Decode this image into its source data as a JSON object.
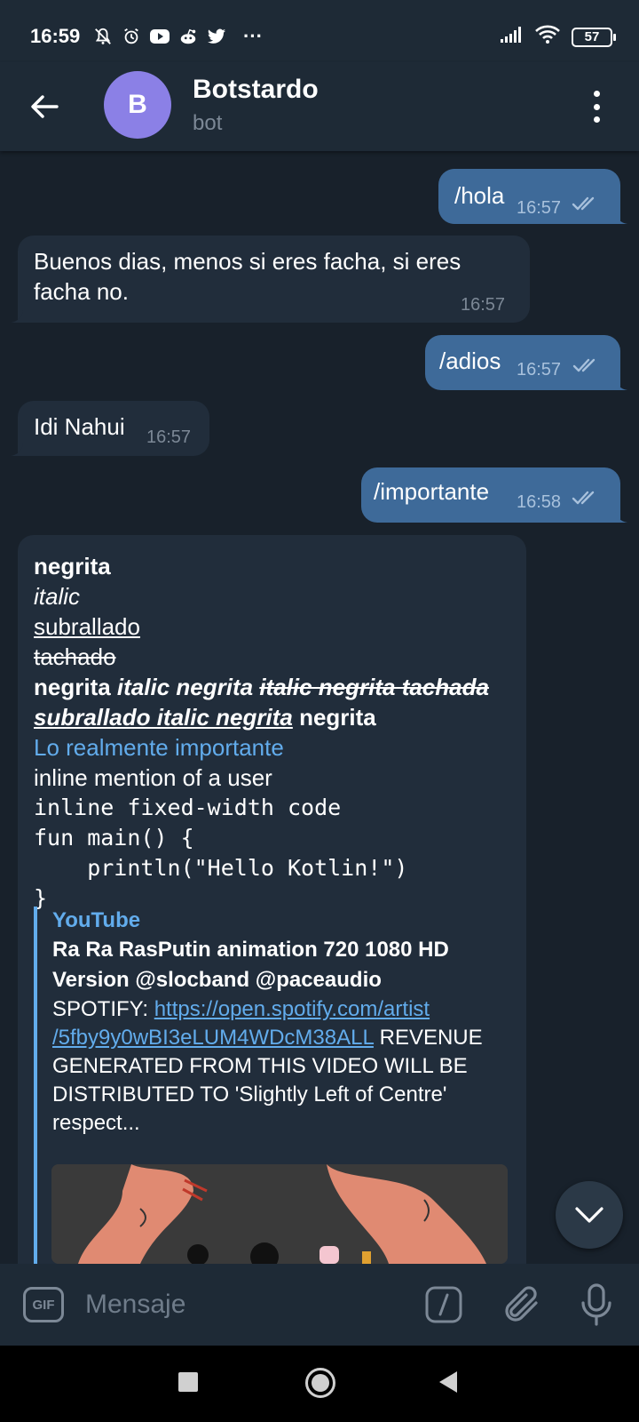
{
  "status_bar": {
    "time": "16:59",
    "battery": "57",
    "more": "···"
  },
  "header": {
    "avatar_letter": "B",
    "title": "Botstardo",
    "subtitle": "bot"
  },
  "messages": [
    {
      "direction": "out",
      "text": "/hola",
      "time": "16:57",
      "status": "read"
    },
    {
      "direction": "in",
      "text_line1": "Buenos dias, menos si eres facha, si eres",
      "text_line2": "facha no.",
      "time": "16:57"
    },
    {
      "direction": "out",
      "text": "/adios",
      "time": "16:57",
      "status": "read"
    },
    {
      "direction": "in",
      "text": "Idi Nahui",
      "time": "16:57"
    },
    {
      "direction": "out",
      "text": "/importante",
      "time": "16:58",
      "status": "read"
    }
  ],
  "formatted": {
    "bold": "negrita",
    "italic": "italic",
    "underline": "subrallado",
    "strike": "tachado",
    "l5_bold": "negrita ",
    "l5_bold_italic": "italic negrita ",
    "l5_strike": "italic negrita tachada",
    "l6_underline": "subrallado italic negrita",
    "l6_bold": " negrita",
    "link": "Lo realmente importante",
    "mention": "inline mention of a user",
    "inline_code": "inline fixed-width code",
    "code_line1": "fun main() {",
    "code_line2": "    println(\"Hello Kotlin!\")",
    "code_line3": "}"
  },
  "link_preview": {
    "site": "YouTube",
    "title_line1": "Ra Ra RasPutin animation 720 1080 HD",
    "title_line2": "Version @slocband @paceaudio",
    "desc_prefix": "SPOTIFY: ",
    "desc_link_line1": "https://open.spotify.com/artist",
    "desc_link_line2": "/5fby9y0wBI3eLUM4WDcM38ALL",
    "desc_after_link": " REVENUE",
    "desc_line3": "GENERATED FROM THIS VIDEO WILL BE",
    "desc_line4": "DISTRIBUTED TO 'Slightly Left of Centre'",
    "desc_line5": "respect..."
  },
  "input": {
    "placeholder": "Mensaje",
    "gif_label": "GIF"
  },
  "colors": {
    "background": "#18212b",
    "header": "#1e2a36",
    "outgoing_bubble": "#3e6a99",
    "incoming_bubble": "#212d3b",
    "accent_link": "#62acec",
    "avatar": "#8b80e6"
  }
}
